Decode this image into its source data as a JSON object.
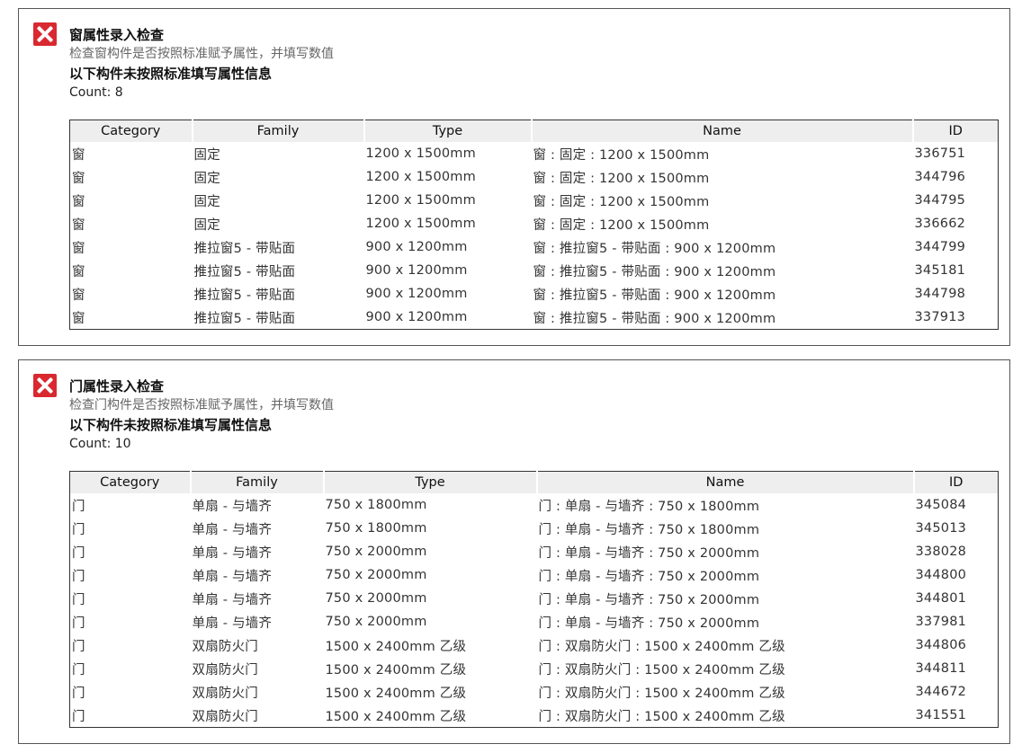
{
  "panels": [
    {
      "title": "窗属性录入检查",
      "subtitle": "检查窗构件是否按照标准赋予属性，并填写数值",
      "heading": "以下构件未按照标准填写属性信息",
      "count": "Count: 8",
      "columns": [
        "Category",
        "Family",
        "Type",
        "Name",
        "ID"
      ],
      "rows": [
        [
          "窗",
          "固定",
          "1200 x 1500mm",
          "窗 : 固定 : 1200 x 1500mm",
          "336751"
        ],
        [
          "窗",
          "固定",
          "1200 x 1500mm",
          "窗 : 固定 : 1200 x 1500mm",
          "344796"
        ],
        [
          "窗",
          "固定",
          "1200 x 1500mm",
          "窗 : 固定 : 1200 x 1500mm",
          "344795"
        ],
        [
          "窗",
          "固定",
          "1200 x 1500mm",
          "窗 : 固定 : 1200 x 1500mm",
          "336662"
        ],
        [
          "窗",
          "推拉窗5 - 带贴面",
          "900 x 1200mm",
          "窗 : 推拉窗5 - 带贴面 : 900 x 1200mm",
          "344799"
        ],
        [
          "窗",
          "推拉窗5 - 带贴面",
          "900 x 1200mm",
          "窗 : 推拉窗5 - 带贴面 : 900 x 1200mm",
          "345181"
        ],
        [
          "窗",
          "推拉窗5 - 带贴面",
          "900 x 1200mm",
          "窗 : 推拉窗5 - 带贴面 : 900 x 1200mm",
          "344798"
        ],
        [
          "窗",
          "推拉窗5 - 带贴面",
          "900 x 1200mm",
          "窗 : 推拉窗5 - 带贴面 : 900 x 1200mm",
          "337913"
        ]
      ]
    },
    {
      "title": "门属性录入检查",
      "subtitle": "检查门构件是否按照标准赋予属性，并填写数值",
      "heading": "以下构件未按照标准填写属性信息",
      "count": "Count: 10",
      "columns": [
        "Category",
        "Family",
        "Type",
        "Name",
        "ID"
      ],
      "rows": [
        [
          "门",
          "单扇 - 与墙齐",
          "750 x 1800mm",
          "门 : 单扇 - 与墙齐 : 750 x 1800mm",
          "345084"
        ],
        [
          "门",
          "单扇 - 与墙齐",
          "750 x 1800mm",
          "门 : 单扇 - 与墙齐 : 750 x 1800mm",
          "345013"
        ],
        [
          "门",
          "单扇 - 与墙齐",
          "750 x 2000mm",
          "门 : 单扇 - 与墙齐 : 750 x 2000mm",
          "338028"
        ],
        [
          "门",
          "单扇 - 与墙齐",
          "750 x 2000mm",
          "门 : 单扇 - 与墙齐 : 750 x 2000mm",
          "344800"
        ],
        [
          "门",
          "单扇 - 与墙齐",
          "750 x 2000mm",
          "门 : 单扇 - 与墙齐 : 750 x 2000mm",
          "344801"
        ],
        [
          "门",
          "单扇 - 与墙齐",
          "750 x 2000mm",
          "门 : 单扇 - 与墙齐 : 750 x 2000mm",
          "337981"
        ],
        [
          "门",
          "双扇防火门",
          "1500 x 2400mm 乙级",
          "门 : 双扇防火门 : 1500 x 2400mm 乙级",
          "344806"
        ],
        [
          "门",
          "双扇防火门",
          "1500 x 2400mm 乙级",
          "门 : 双扇防火门 : 1500 x 2400mm 乙级",
          "344811"
        ],
        [
          "门",
          "双扇防火门",
          "1500 x 2400mm 乙级",
          "门 : 双扇防火门 : 1500 x 2400mm 乙级",
          "344672"
        ],
        [
          "门",
          "双扇防火门",
          "1500 x 2400mm 乙级",
          "门 : 双扇防火门 : 1500 x 2400mm 乙级",
          "341551"
        ]
      ]
    }
  ],
  "icons": {
    "status": "fail-x-icon"
  },
  "colors": {
    "fail": "#d9282f",
    "header_bg": "#eeeeee",
    "border": "#555555"
  }
}
